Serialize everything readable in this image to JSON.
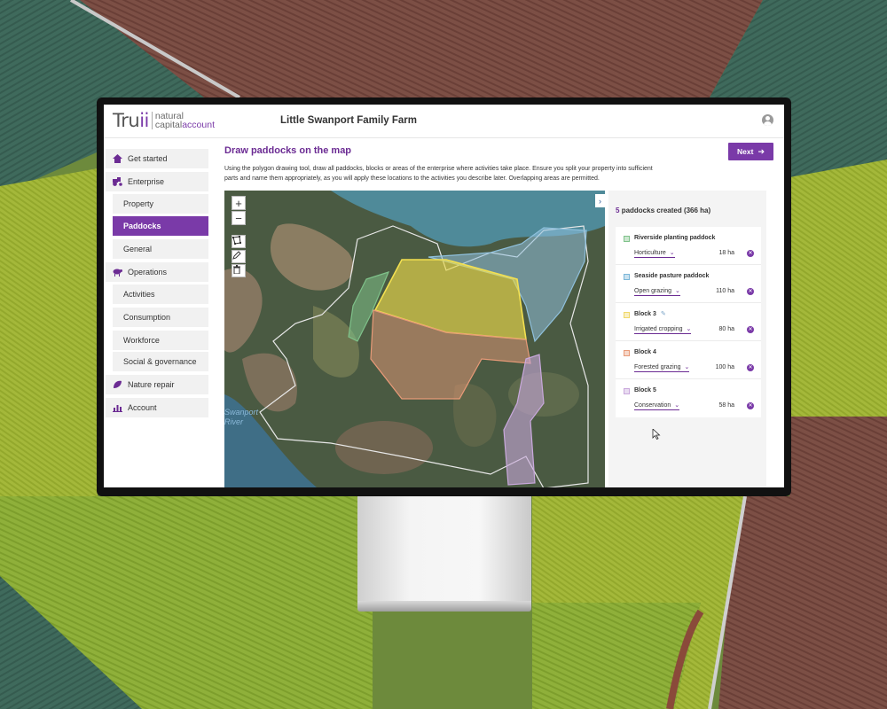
{
  "app": {
    "logo": {
      "brand": "Truii",
      "line1": "natural",
      "line2": "capital",
      "line3": "account"
    },
    "farm_title": "Little Swanport Family Farm"
  },
  "sidebar": {
    "items": [
      {
        "label": "Get started",
        "icon": "house-icon",
        "kind": "section"
      },
      {
        "label": "Enterprise",
        "icon": "tractor-icon",
        "kind": "section"
      },
      {
        "label": "Property",
        "kind": "sub"
      },
      {
        "label": "Paddocks",
        "kind": "sub",
        "active": true
      },
      {
        "label": "General",
        "kind": "sub"
      },
      {
        "label": "Operations",
        "icon": "sheep-icon",
        "kind": "section"
      },
      {
        "label": "Activities",
        "kind": "sub"
      },
      {
        "label": "Consumption",
        "kind": "sub"
      },
      {
        "label": "Workforce",
        "kind": "sub"
      },
      {
        "label": "Social & governance",
        "kind": "sub"
      },
      {
        "label": "Nature repair",
        "icon": "leaf-icon",
        "kind": "section"
      },
      {
        "label": "Account",
        "icon": "chart-icon",
        "kind": "section"
      }
    ]
  },
  "main": {
    "title": "Draw paddocks on the map",
    "next_label": "Next",
    "intro": "Using the polygon drawing tool, draw all paddocks, blocks or areas of the enterprise where activities take place. Ensure you split your property into sufficient parts and name them appropriately, as you will apply these locations to the activities you describe later. Overlapping areas are permitted."
  },
  "map": {
    "zoom_in": "+",
    "zoom_out": "−",
    "river_label_1": "Swanport",
    "river_label_2": "River"
  },
  "panel": {
    "count": "5",
    "summary": "paddocks created (366 ha)",
    "paddocks": [
      {
        "name": "Riverside planting paddock",
        "type": "Horticulture",
        "area": "18 ha",
        "color": "#7fc28a",
        "editing": false
      },
      {
        "name": "Seaside pasture paddock",
        "type": "Open grazing",
        "area": "110 ha",
        "color": "#7ab6d8",
        "editing": false
      },
      {
        "name": "Block 3",
        "type": "Irrigated cropping",
        "area": "80 ha",
        "color": "#f0d86a",
        "editing": true
      },
      {
        "name": "Block 4",
        "type": "Forested grazing",
        "area": "100 ha",
        "color": "#e89a78",
        "editing": false
      },
      {
        "name": "Block 5",
        "type": "Conservation",
        "area": "58 ha",
        "color": "#c9a8dc",
        "editing": false
      }
    ]
  },
  "colors": {
    "accent": "#7a3aa8",
    "title": "#6b2b93"
  }
}
